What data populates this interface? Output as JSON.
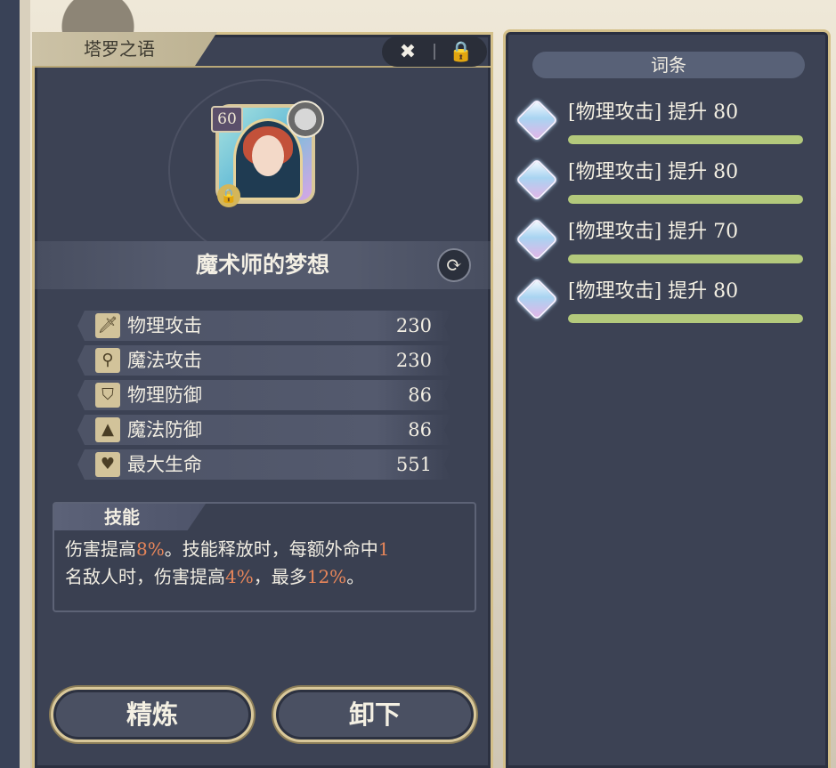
{
  "left_panel": {
    "tab_title": "塔罗之语",
    "close_icon": "close-x-icon",
    "lock_icon": "lock-icon",
    "card": {
      "level": "60",
      "lock_icon": "lock-icon",
      "portrait": "magician-portrait"
    },
    "item_name": "魔术师的梦想",
    "refresh_icon": "refresh-icon",
    "stats": [
      {
        "icon": "sword-icon",
        "glyph": "🗡",
        "label": "物理攻击",
        "value": "230"
      },
      {
        "icon": "wand-icon",
        "glyph": "⚲",
        "label": "魔法攻击",
        "value": "230"
      },
      {
        "icon": "shield-icon",
        "glyph": "⛉",
        "label": "物理防御",
        "value": "86"
      },
      {
        "icon": "wizard-hat-icon",
        "glyph": "▲",
        "label": "魔法防御",
        "value": "86"
      },
      {
        "icon": "heart-icon",
        "glyph": "♥",
        "label": "最大生命",
        "value": "551"
      }
    ],
    "skill": {
      "title": "技能",
      "text": [
        {
          "t": "伤害提高",
          "hl": false
        },
        {
          "t": "8%",
          "hl": true
        },
        {
          "t": "。技能释放时，每额外命中",
          "hl": false
        },
        {
          "t": "1",
          "hl": true
        },
        {
          "t": "名敌人时，伤害提高",
          "hl": false
        },
        {
          "t": "4%",
          "hl": true
        },
        {
          "t": "，最多",
          "hl": false
        },
        {
          "t": "12%",
          "hl": true
        },
        {
          "t": "。",
          "hl": false
        }
      ]
    },
    "buttons": {
      "refine": "精炼",
      "unequip": "卸下"
    }
  },
  "right_panel": {
    "title": "词条",
    "affixes": [
      {
        "text": "[物理攻击] 提升 80",
        "fill": 1.0
      },
      {
        "text": "[物理攻击] 提升 80",
        "fill": 1.0
      },
      {
        "text": "[物理攻击] 提升 70",
        "fill": 1.0
      },
      {
        "text": "[物理攻击] 提升 80",
        "fill": 1.0
      }
    ]
  },
  "colors": {
    "panel": "#3c4254",
    "gold_border": "#d4c08a",
    "highlight": "#e8865a",
    "affix_bar": "#b3c97c"
  }
}
